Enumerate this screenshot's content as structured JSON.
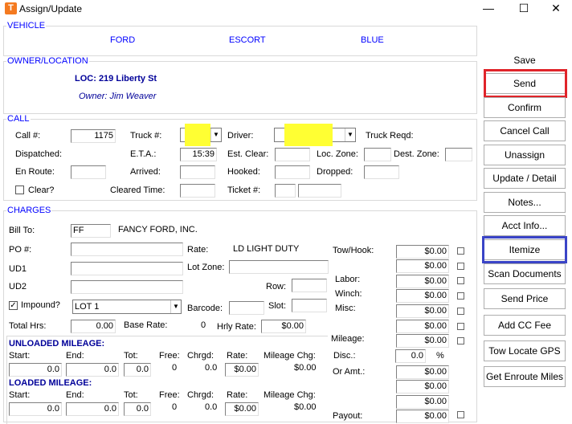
{
  "window": {
    "title": "Assign/Update",
    "app_icon": "T",
    "minimize": "—",
    "maximize": "☐",
    "close": "✕"
  },
  "vehicle": {
    "legend": "VEHICLE",
    "make": "FORD",
    "model": "ESCORT",
    "color": "BLUE"
  },
  "owner": {
    "legend": "OWNER/LOCATION",
    "loc": "LOC: 219 Liberty St",
    "owner": "Owner: Jim Weaver"
  },
  "call": {
    "legend": "CALL",
    "call_no_label": "Call #:",
    "call_no": "1175",
    "truck_label": "Truck #:",
    "truck_value": "",
    "driver_label": "Driver:",
    "driver_value": "",
    "truck_reqd_label": "Truck Reqd:",
    "dispatched_label": "Dispatched:",
    "eta_label": "E.T.A.:",
    "eta": "15:39",
    "est_clear_label": "Est. Clear:",
    "loc_zone_label": "Loc. Zone:",
    "dest_zone_label": "Dest. Zone:",
    "en_route_label": "En Route:",
    "arrived_label": "Arrived:",
    "hooked_label": "Hooked:",
    "dropped_label": "Dropped:",
    "clear_label": "Clear?",
    "cleared_time_label": "Cleared Time:",
    "ticket_label": "Ticket #:"
  },
  "charges": {
    "legend": "CHARGES",
    "bill_to_label": "Bill To:",
    "bill_to_code": "FF",
    "bill_to_name": "FANCY FORD, INC.",
    "po_label": "PO #:",
    "rate_label": "Rate:",
    "rate_value": "LD LIGHT DUTY",
    "ud1_label": "UD1",
    "lot_zone_label": "Lot Zone:",
    "ud2_label": "UD2",
    "row_label": "Row:",
    "impound_label": "Impound?",
    "impound_lot": "LOT 1",
    "barcode_label": "Barcode:",
    "slot_label": "Slot:",
    "total_hrs_label": "Total Hrs:",
    "total_hrs": "0.00",
    "base_rate_label": "Base Rate:",
    "base_rate": "0",
    "hrly_rate_label": "Hrly Rate:",
    "hrly_rate": "$0.00",
    "tow_hook_label": "Tow/Hook:",
    "labor_label": "Labor:",
    "winch_label": "Winch:",
    "misc_label": "Misc:",
    "mileage_label": "Mileage:",
    "disc_label": "Disc.:",
    "disc_value": "0.0",
    "disc_unit": "%",
    "or_amt_label": "Or Amt.:",
    "payout_label": "Payout:",
    "amounts": [
      "$0.00",
      "$0.00",
      "$0.00",
      "$0.00",
      "$0.00",
      "$0.00",
      "$0.00",
      "$0.00",
      "$0.00",
      "$0.00",
      "$0.00",
      "$0.00"
    ],
    "unloaded": {
      "title": "UNLOADED MILEAGE:",
      "start_label": "Start:",
      "end_label": "End:",
      "tot_label": "Tot:",
      "free_label": "Free:",
      "chrgd_label": "Chrgd:",
      "rate_label": "Rate:",
      "chg_label": "Mileage Chg:",
      "start": "0.0",
      "end": "0.0",
      "tot": "0.0",
      "free": "0",
      "chrgd": "0.0",
      "rate": "$0.00",
      "chg": "$0.00"
    },
    "loaded": {
      "title": "LOADED MILEAGE:",
      "start_label": "Start:",
      "end_label": "End:",
      "tot_label": "Tot:",
      "free_label": "Free:",
      "chrgd_label": "Chrgd:",
      "rate_label": "Rate:",
      "chg_label": "Mileage Chg:",
      "start": "0.0",
      "end": "0.0",
      "tot": "0.0",
      "free": "0",
      "chrgd": "0.0",
      "rate": "$0.00",
      "chg": "$0.00"
    }
  },
  "sidebar": {
    "save": "Save",
    "send": "Send",
    "confirm": "Confirm",
    "cancel_call": "Cancel Call",
    "unassign": "Unassign",
    "update_detail": "Update / Detail",
    "notes": "Notes...",
    "acct_info": "Acct Info...",
    "itemize": "Itemize",
    "scan_documents": "Scan Documents",
    "send_price": "Send Price",
    "add_cc_fee": "Add CC Fee",
    "tow_locate_gps": "Tow Locate GPS",
    "get_enroute_miles": "Get Enroute Miles"
  },
  "colors": {
    "highlight_yellow": "#ffff33",
    "annotation_red": "#e0242a",
    "annotation_blue": "#3a44c7",
    "legend_blue": "#0000ff"
  }
}
